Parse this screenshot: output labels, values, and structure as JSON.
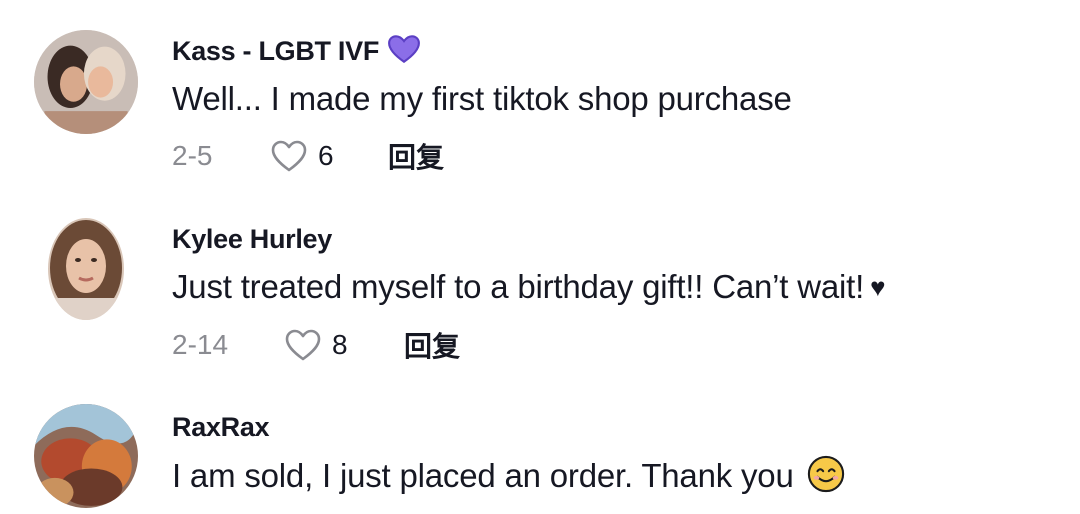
{
  "comments": [
    {
      "username": "Kass - LGBT IVF",
      "text": "Well... I made my first tiktok shop purchase",
      "date": "2-5",
      "likes": "6",
      "reply_label": "回复",
      "badge_color": "#7b5bd6"
    },
    {
      "username": "Kylee Hurley",
      "text": "Just treated myself to a birthday gift!! Can’t wait!",
      "trailing_symbol": "♥",
      "date": "2-14",
      "likes": "8",
      "reply_label": "回复"
    },
    {
      "username": "RaxRax",
      "text": "I am sold, I just placed an order. Thank you",
      "emoji": "smiling-face-emoji"
    }
  ],
  "colors": {
    "text_primary": "#161823",
    "text_secondary": "#8a8b91",
    "badge_purple": "#7b5bd6",
    "emoji_yellow": "#f7c948"
  }
}
